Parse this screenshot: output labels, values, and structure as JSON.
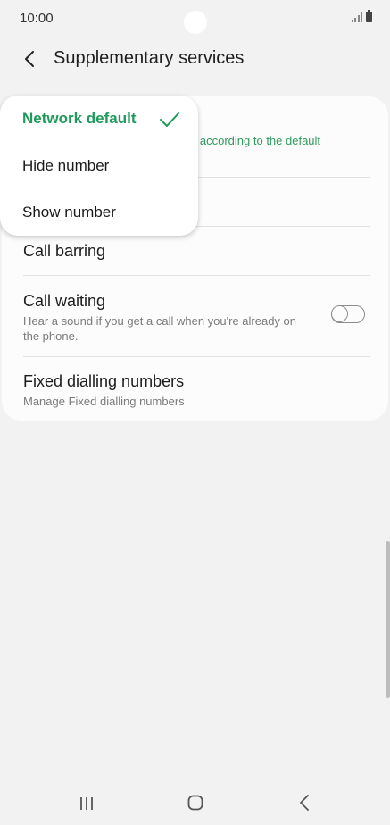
{
  "status_bar": {
    "time": "10:00"
  },
  "header": {
    "title": "Supplementary services"
  },
  "settings": {
    "hidden_row_partial_text": "lls according to the default",
    "call_barring": {
      "title": "Call barring"
    },
    "call_waiting": {
      "title": "Call waiting",
      "subtitle": "Hear a sound if you get a call when you're already on the phone.",
      "enabled": false
    },
    "fixed_dialling": {
      "title": "Fixed dialling numbers",
      "subtitle": "Manage Fixed dialling numbers"
    }
  },
  "popup": {
    "options": [
      {
        "label": "Network default",
        "selected": true
      },
      {
        "label": "Hide number",
        "selected": false
      },
      {
        "label": "Show number",
        "selected": false
      }
    ]
  },
  "colors": {
    "accent": "#1e9a5a",
    "background": "#f2f2f2",
    "card": "#fcfcfc"
  }
}
